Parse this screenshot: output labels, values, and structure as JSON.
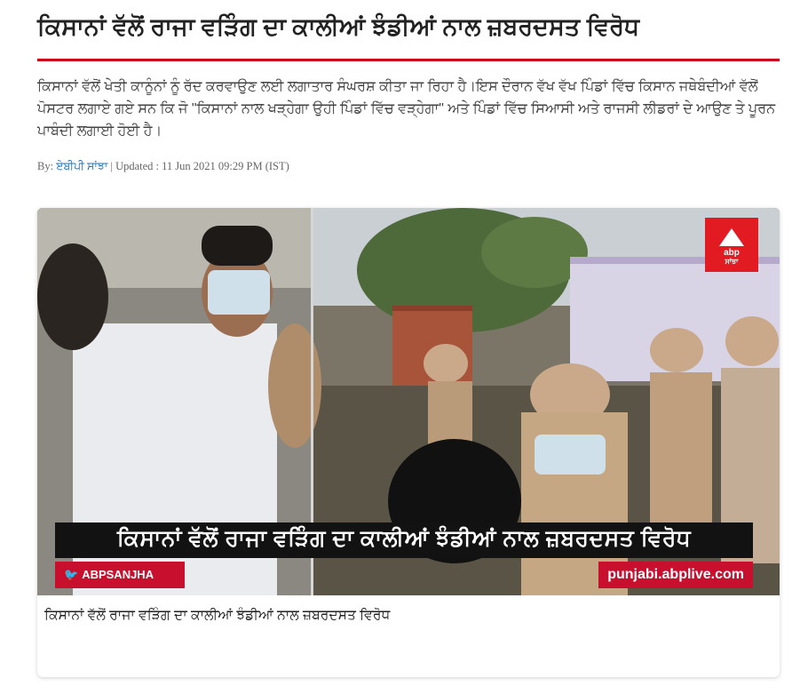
{
  "article": {
    "title": "ਕਿਸਾਨਾਂ ਵੱਲੋਂ ਰਾਜਾ ਵੜਿੰਗ ਦਾ ਕਾਲੀਆਂ ਝੰਡੀਆਂ ਨਾਲ ਜ਼ਬਰਦਸਤ ਵਿਰੋਧ",
    "summary": "ਕਿਸਾਨਾਂ ਵੱਲੋਂ ਖੇਤੀ ਕਾਨੂੰਨਾਂ ਨੂੰ ਰੱਦ ਕਰਵਾਉਣ ਲਈ ਲਗਾਤਾਰ ਸੰਘਰਸ਼ ਕੀਤਾ ਜਾ ਰਿਹਾ ਹੈ।ਇਸ ਦੌਰਾਨ ਵੱਖ ਵੱਖ ਪਿੰਡਾਂ ਵਿੱਚ ਕਿਸਾਨ ਜਥੇਬੰਦੀਆਂ ਵੱਲੋਂ ਪੋਸਟਰ ਲਗਾਏ ਗਏ ਸਨ ਕਿ ਜੋ \"ਕਿਸਾਨਾਂ ਨਾਲ ਖੜ੍ਹੇਗਾ ਉਹੀ ਪਿੰਡਾਂ ਵਿੱਚ ਵੜ੍ਹੇਗਾ\" ਅਤੇ ਪਿੰਡਾਂ ਵਿੱਚ ਸਿਆਸੀ ਅਤੇ ਰਾਜਸੀ ਲੀਡਰਾਂ ਦੇ ਆਉਣ ਤੇ ਪੂਰਨ ਪਾਬੰਦੀ ਲਗਾਈ ਹੋਈ ਹੈ।",
    "byline_prefix": "By: ",
    "author": "ਏਬੀਪੀ ਸਾਂਝਾ",
    "updated": " | Updated : 11 Jun 2021 09:29 PM (IST)"
  },
  "media": {
    "caption": "ਕਿਸਾਨਾਂ ਵੱਲੋਂ ਰਾਜਾ ਵੜਿੰਗ ਦਾ ਕਾਲੀਆਂ ਝੰਡੀਆਂ ਨਾਲ ਜ਼ਬਰਦਸਤ ਵਿਰੋਧ",
    "logo_text_1": "abp",
    "logo_text_2": "ਸਾਂਝਾ",
    "overlay_headline": "ਕਿਸਾਨਾਂ ਵੱਲੋਂ ਰਾਜਾ ਵੜਿੰਗ ਦਾ ਕਾਲੀਆਂ ਝੰਡੀਆਂ ਨਾਲ ਜ਼ਬਰਦਸਤ ਵਿਰੋਧ",
    "social_handle": "ABPSANJHA",
    "site_url": "punjabi.abplive.com"
  },
  "colors": {
    "accent_red": "#d0021b",
    "author_link": "#1a73c8"
  }
}
